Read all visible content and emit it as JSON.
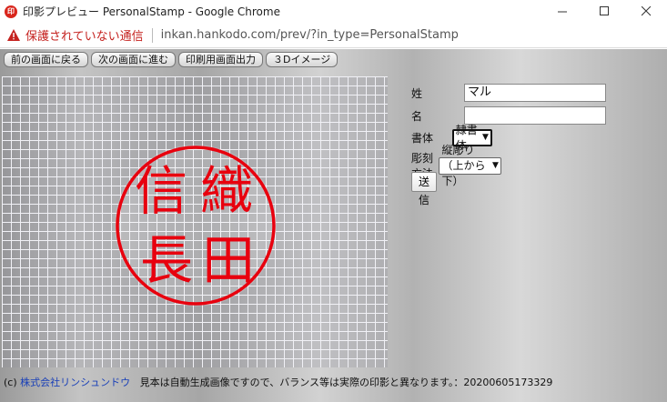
{
  "window": {
    "icon_text": "印",
    "title": "印影プレビュー PersonalStamp - Google Chrome",
    "minimize": "—",
    "maximize": "☐",
    "close": "✕"
  },
  "address": {
    "security_text": "保護されていない通信",
    "url": "inkan.hankodo.com/prev/?in_type=PersonalStamp"
  },
  "toolbar": {
    "buttons": [
      "前の画面に戻る",
      "次の画面に進む",
      "印刷用画面出力",
      "３Dイメージ"
    ]
  },
  "stamp": {
    "chars": [
      "信",
      "織",
      "長",
      "田"
    ],
    "color": "#e8000e"
  },
  "form": {
    "sei_label": "姓",
    "sei_value": "マル",
    "mei_label": "名",
    "mei_value": "",
    "font_label": "書体",
    "font_value": "隷書体",
    "method_label": "彫刻方法",
    "method_value": "縦彫り（上から下）",
    "submit_label": "送信"
  },
  "footer": {
    "copyright_prefix": "(c) ",
    "company": "株式会社リンシュンドウ",
    "notice": "見本は自動生成画像ですので、バランス等は実際の印影と異なります。：20200605173329"
  }
}
